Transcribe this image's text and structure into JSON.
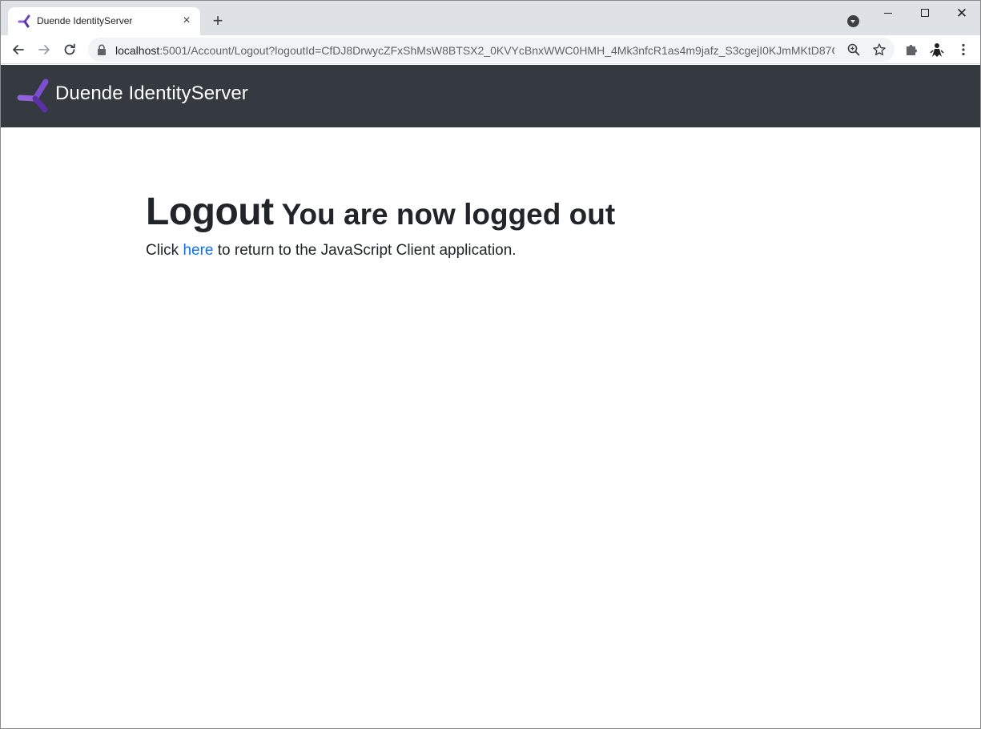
{
  "browser": {
    "tab_title": "Duende IdentityServer",
    "new_tab_label": "+",
    "url_host": "localhost",
    "url_rest": ":5001/Account/Logout?logoutId=CfDJ8DrwycZFxShMsW8BTSX2_0KVYcBnxWWC0HMH_4Mk3nfcR1as4m9jafz_S3cgejI0KJmMKtD87Gkq..."
  },
  "site": {
    "brand": "Duende IdentityServer",
    "brand_color": "#6f42c1",
    "navbar_color": "#343a40"
  },
  "page": {
    "title": "Logout",
    "subtitle": "You are now logged out",
    "message_prefix": "Click ",
    "link_text": "here",
    "message_suffix": " to return to the JavaScript Client application.",
    "link_color": "#0d6efd"
  },
  "icons": {
    "tab_close": "×",
    "window_close": "✕"
  }
}
